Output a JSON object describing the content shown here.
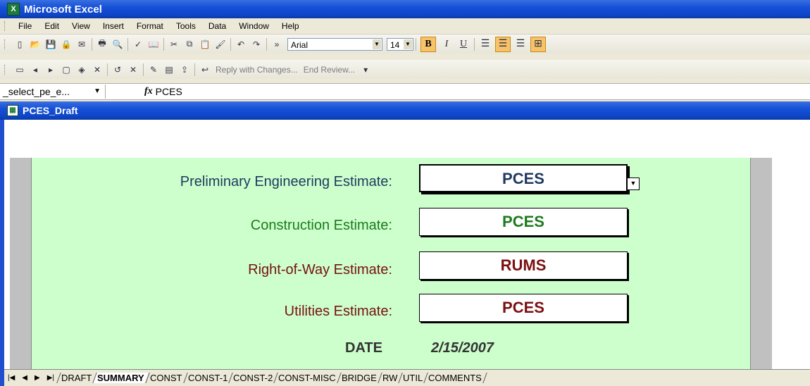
{
  "app": {
    "title": "Microsoft Excel"
  },
  "menubar": {
    "items": [
      "File",
      "Edit",
      "View",
      "Insert",
      "Format",
      "Tools",
      "Data",
      "Window",
      "Help"
    ]
  },
  "toolbar": {
    "font": "Arial",
    "size": "14",
    "bold": "B",
    "italic": "I",
    "underline": "U",
    "reply_with_changes": "Reply with Changes...",
    "end_review": "End Review..."
  },
  "formula_bar": {
    "name_box": "_select_pe_e...",
    "fx": "fx",
    "formula": "PCES"
  },
  "workbook": {
    "title": "PCES_Draft"
  },
  "estimates": [
    {
      "label": "Preliminary Engineering Estimate:",
      "value": "PCES",
      "label_color": "#1f3a5f",
      "value_color": "#1f3a5f"
    },
    {
      "label": "Construction Estimate:",
      "value": "PCES",
      "label_color": "#1e7a1e",
      "value_color": "#1e7a1e"
    },
    {
      "label": "Right-of-Way Estimate:",
      "value": "RUMS",
      "label_color": "#7a1010",
      "value_color": "#7a1010"
    },
    {
      "label": "Utilities Estimate:",
      "value": "PCES",
      "label_color": "#7a1010",
      "value_color": "#7a1010"
    }
  ],
  "date": {
    "label": "DATE",
    "value": "2/15/2007"
  },
  "sheet_tabs": [
    "DRAFT",
    "SUMMARY",
    "CONST",
    "CONST-1",
    "CONST-2",
    "CONST-MISC",
    "BRIDGE",
    "RW",
    "UTIL",
    "COMMENTS"
  ],
  "active_tab": "SUMMARY"
}
